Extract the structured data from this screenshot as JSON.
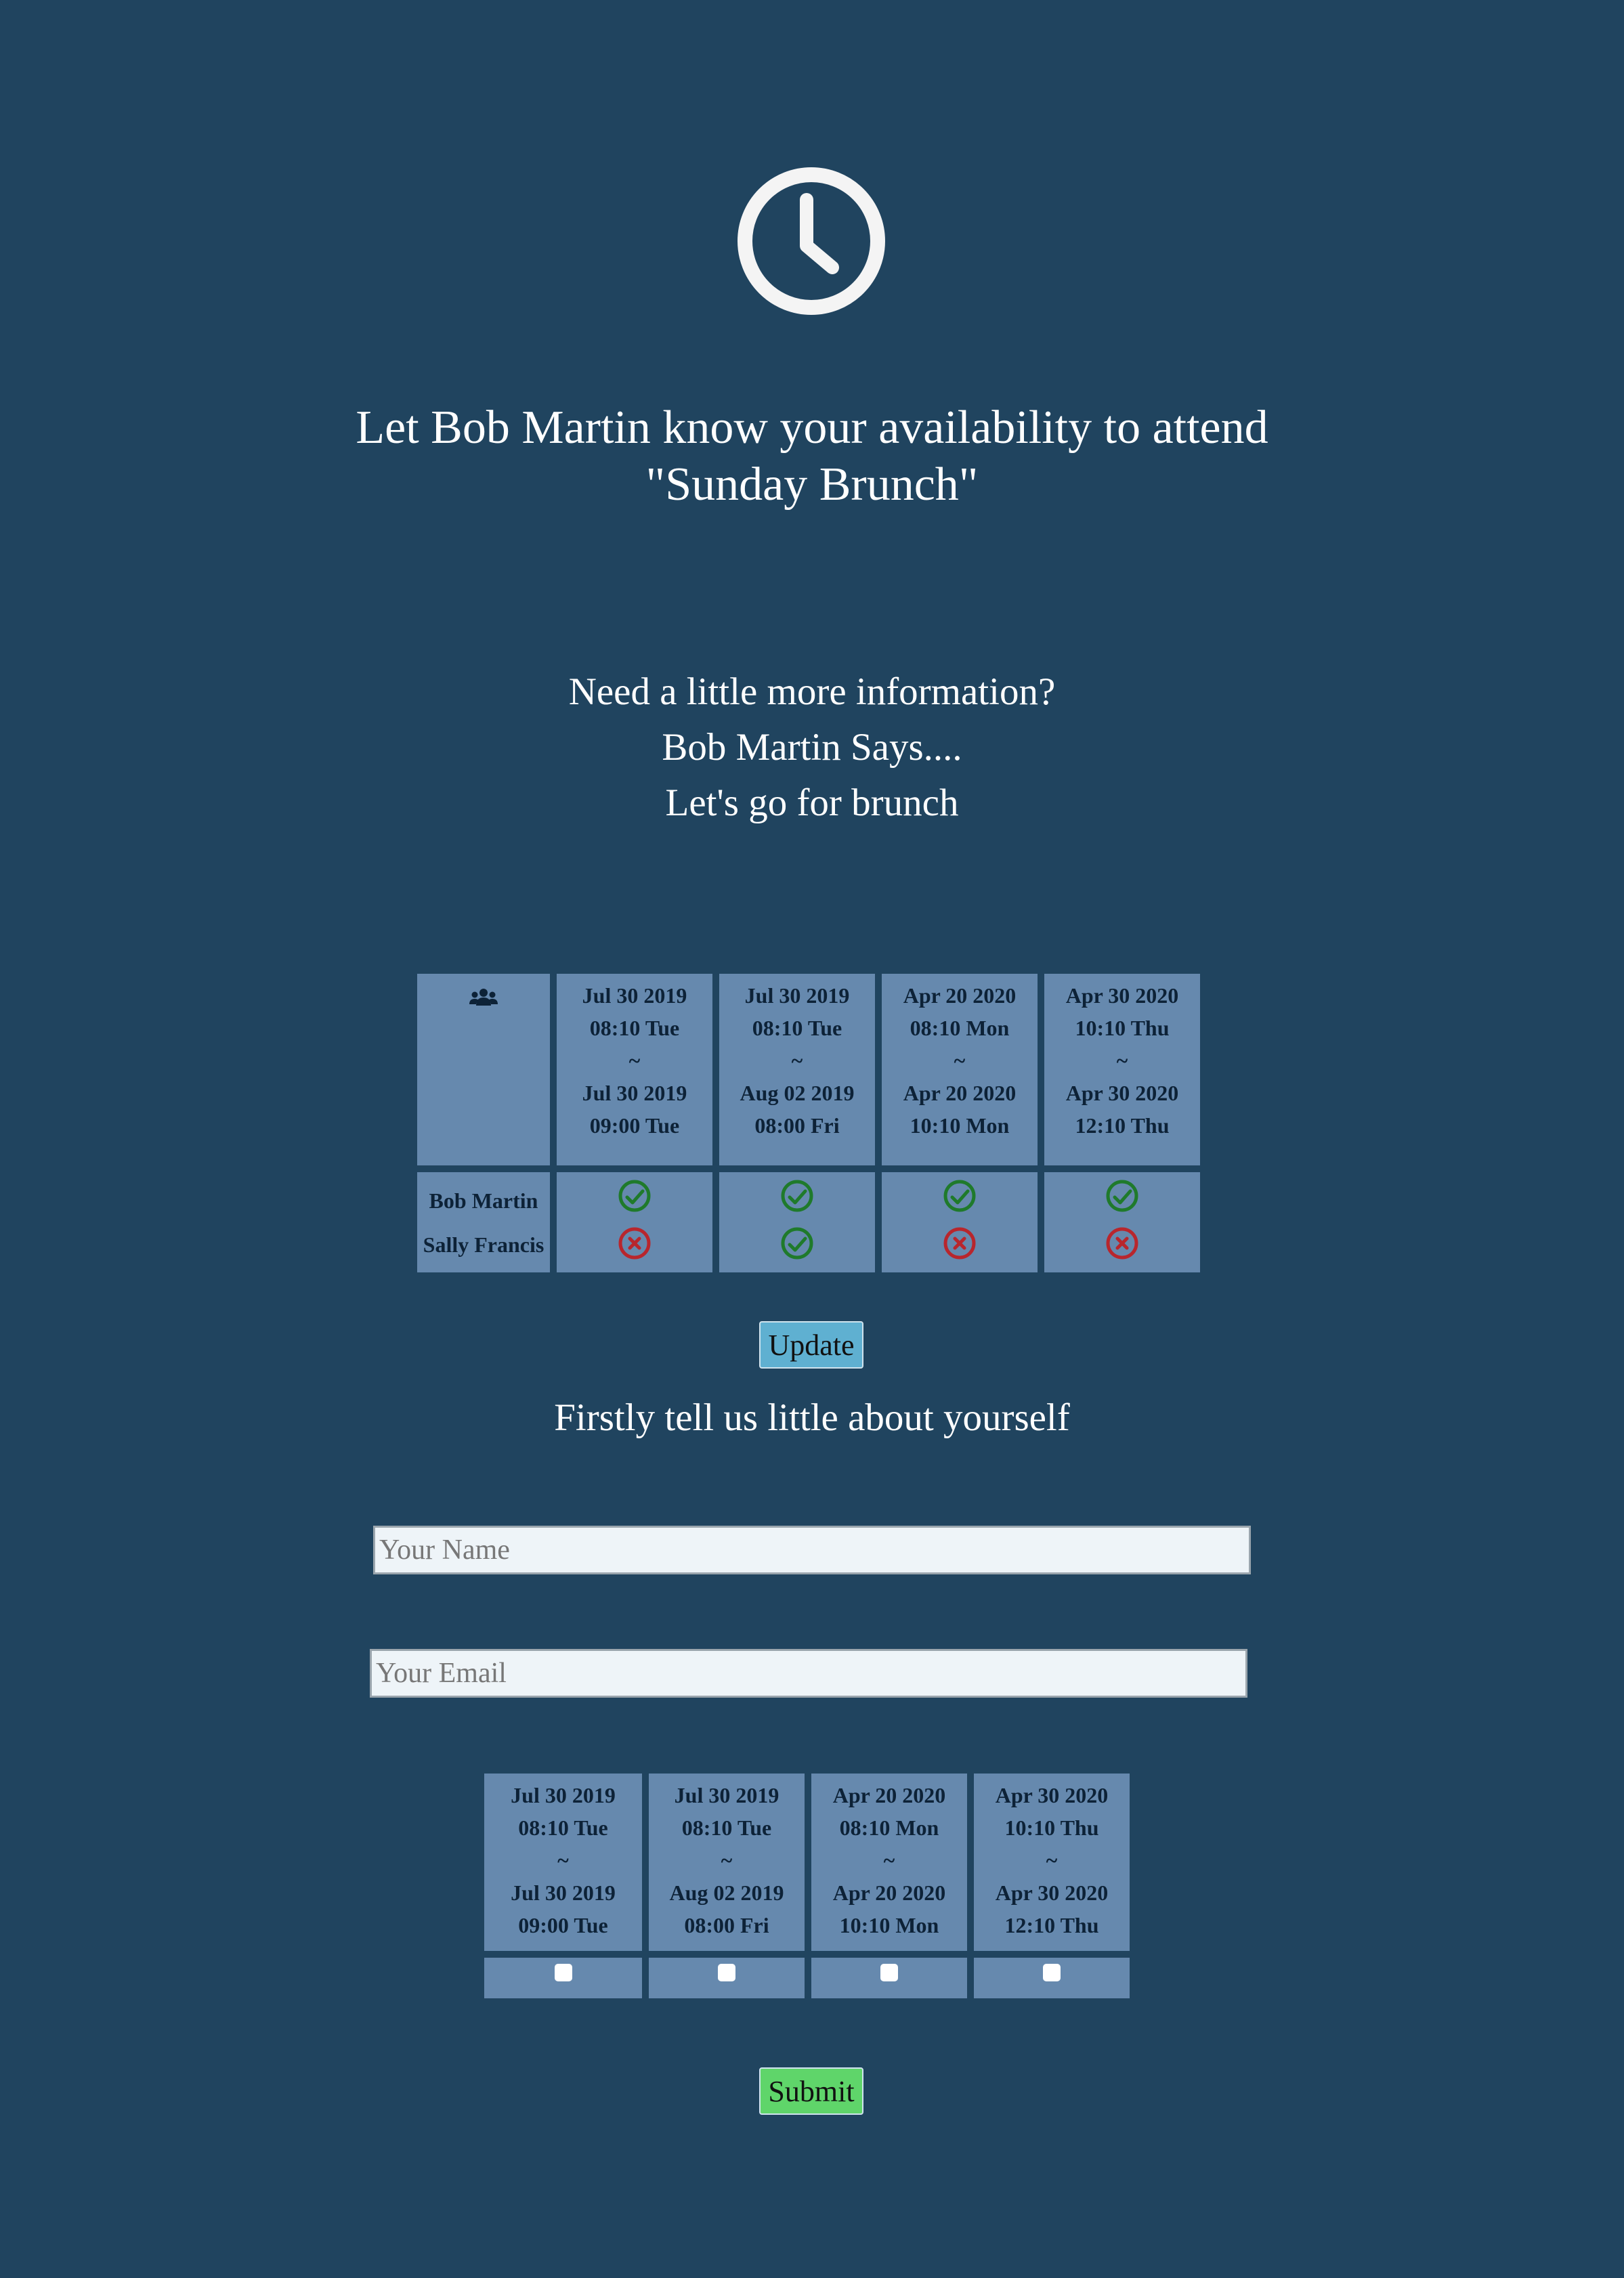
{
  "header": {
    "icon": "clock-icon",
    "title_line1": "Let Bob Martin know your availability to attend",
    "title_line2": "\"Sunday Brunch\""
  },
  "info": {
    "line1": "Need a little more information?",
    "line2": "Bob Martin Says....",
    "line3": "Let's go for brunch"
  },
  "availability": {
    "people_icon": "users-icon",
    "slots": [
      {
        "start_date": "Jul 30 2019",
        "start_time": "08:10 Tue",
        "sep": "~",
        "end_date": "Jul 30 2019",
        "end_time": "09:00 Tue"
      },
      {
        "start_date": "Jul 30 2019",
        "start_time": "08:10 Tue",
        "sep": "~",
        "end_date": "Aug 02 2019",
        "end_time": "08:00 Fri"
      },
      {
        "start_date": "Apr 20 2020",
        "start_time": "08:10 Mon",
        "sep": "~",
        "end_date": "Apr 20 2020",
        "end_time": "10:10 Mon"
      },
      {
        "start_date": "Apr 30 2020",
        "start_time": "10:10 Thu",
        "sep": "~",
        "end_date": "Apr 30 2020",
        "end_time": "12:10 Thu"
      }
    ],
    "people": [
      {
        "name": "Bob Martin",
        "status": [
          "yes",
          "yes",
          "yes",
          "yes"
        ]
      },
      {
        "name": "Sally Francis",
        "status": [
          "no",
          "yes",
          "no",
          "no"
        ]
      }
    ],
    "colors": {
      "yes": "#1f7a2b",
      "no": "#b8262d"
    }
  },
  "update_button": "Update",
  "form": {
    "heading": "Firstly tell us little about yourself",
    "name_placeholder": "Your Name",
    "name_value": "",
    "email_placeholder": "Your Email",
    "email_value": "",
    "slots": [
      {
        "start_date": "Jul 30 2019",
        "start_time": "08:10 Tue",
        "sep": "~",
        "end_date": "Jul 30 2019",
        "end_time": "09:00 Tue",
        "checked": false
      },
      {
        "start_date": "Jul 30 2019",
        "start_time": "08:10 Tue",
        "sep": "~",
        "end_date": "Aug 02 2019",
        "end_time": "08:00 Fri",
        "checked": false
      },
      {
        "start_date": "Apr 20 2020",
        "start_time": "08:10 Mon",
        "sep": "~",
        "end_date": "Apr 20 2020",
        "end_time": "10:10 Mon",
        "checked": false
      },
      {
        "start_date": "Apr 30 2020",
        "start_time": "10:10 Thu",
        "sep": "~",
        "end_date": "Apr 30 2020",
        "end_time": "12:10 Thu",
        "checked": false
      }
    ],
    "submit": "Submit"
  }
}
